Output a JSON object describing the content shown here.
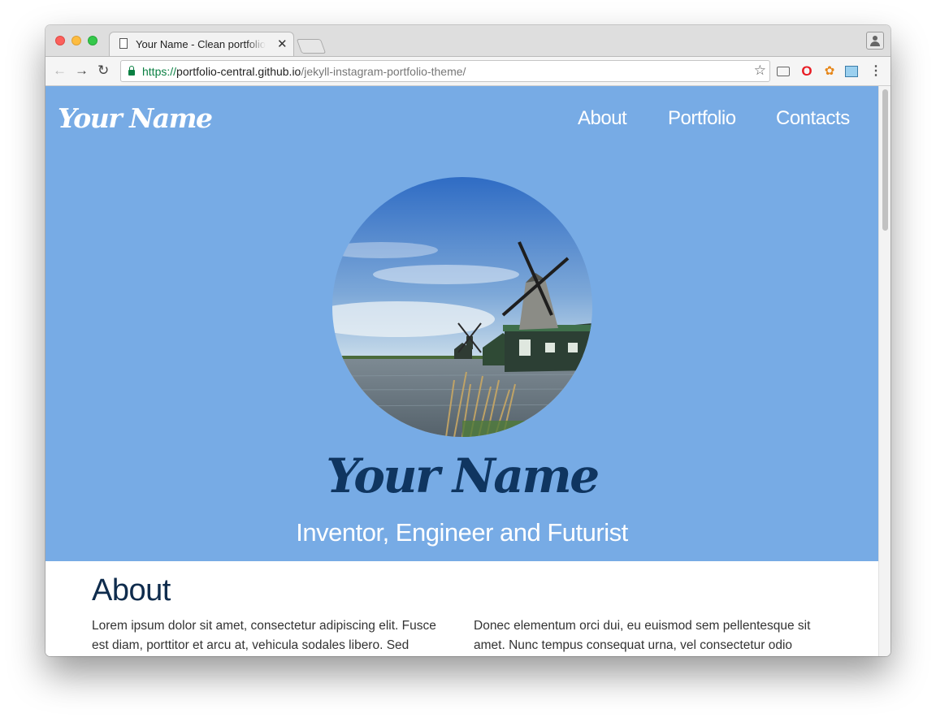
{
  "browser": {
    "tab_title": "Your Name - Clean portfolio theme",
    "tab_close": "✕",
    "url": {
      "scheme": "https://",
      "host": "portfolio-central.github.io",
      "path": "/jekyll-instagram-portfolio-theme/"
    },
    "icons": {
      "back": "back-arrow-icon",
      "forward": "forward-arrow-icon",
      "reload": "reload-icon",
      "secure": "lock-icon",
      "bookmark": "star-icon",
      "cast": "cast-icon",
      "opera": "opera-icon",
      "extension": "pepper-icon",
      "screenshot": "screenshot-icon",
      "menu": "kebab-menu-icon",
      "profile": "profile-icon"
    }
  },
  "site": {
    "logo": "Your Name",
    "nav": [
      "About",
      "Portfolio",
      "Contacts"
    ],
    "hero": {
      "name": "Your Name",
      "tagline": "Inventor, Engineer and Futurist",
      "image_alt": "windmill-photo"
    },
    "about": {
      "heading": "About",
      "col1": "Lorem ipsum dolor sit amet, consectetur adipiscing elit. Fusce est diam, porttitor et arcu at, vehicula sodales libero. Sed",
      "col2": "Donec elementum orci dui, eu euismod sem pellentesque sit amet. Nunc tempus consequat urna, vel consectetur odio"
    }
  },
  "colors": {
    "hero_background": "#77abe5",
    "hero_name": "#0f3560",
    "about_heading": "#0f2c4d",
    "secure_green": "#0b8043"
  }
}
